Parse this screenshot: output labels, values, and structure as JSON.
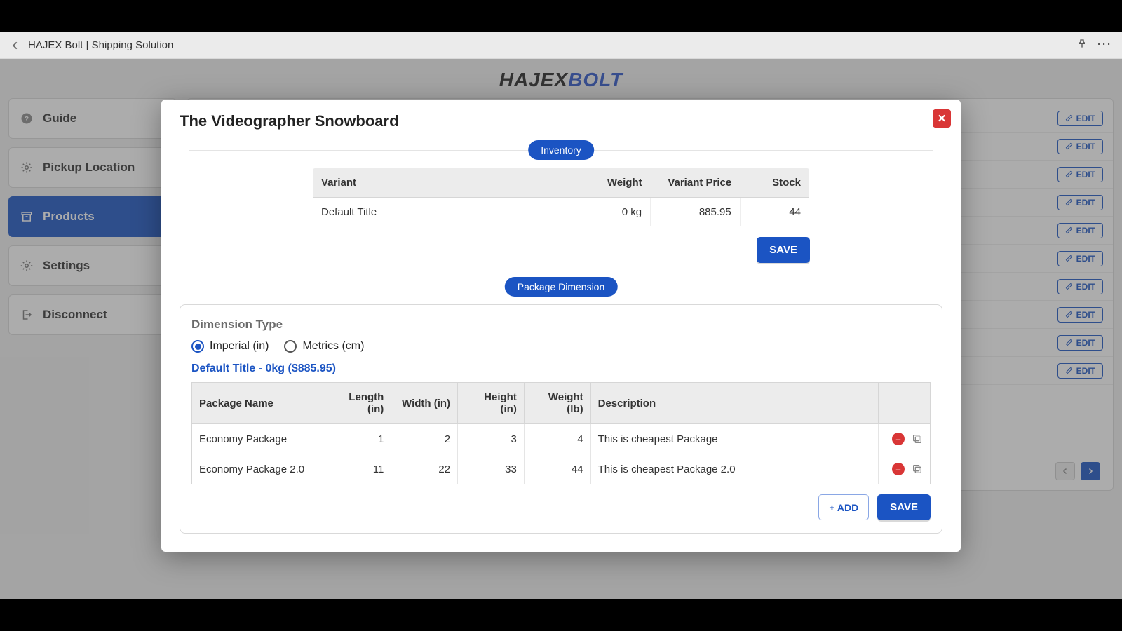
{
  "titlebar": {
    "text": "HAJEX Bolt | Shipping Solution"
  },
  "brand": {
    "part1": "HAJEX",
    "part2": "BOLT"
  },
  "sidebar": {
    "items": [
      {
        "label": "Guide"
      },
      {
        "label": "Pickup Location"
      },
      {
        "label": "Products"
      },
      {
        "label": "Settings"
      },
      {
        "label": "Disconnect"
      }
    ]
  },
  "main": {
    "edit_label": "EDIT",
    "row_count": 10
  },
  "modal": {
    "title": "The Videographer Snowboard",
    "inventory_label": "Inventory",
    "package_dim_label": "Package Dimension",
    "inv_headers": {
      "variant": "Variant",
      "weight": "Weight",
      "price": "Variant Price",
      "stock": "Stock"
    },
    "inv_row": {
      "variant": "Default Title",
      "weight": "0 kg",
      "price": "885.95",
      "stock": "44"
    },
    "save_label": "SAVE",
    "dimension_type_label": "Dimension Type",
    "radio_imperial": "Imperial (in)",
    "radio_metrics": "Metrics (cm)",
    "variant_link": "Default Title - 0kg ($885.95)",
    "pkg_headers": {
      "name": "Package Name",
      "length": "Length (in)",
      "width": "Width (in)",
      "height": "Height (in)",
      "weight": "Weight (lb)",
      "desc": "Description"
    },
    "pkg_rows": [
      {
        "name": "Economy Package",
        "length": "1",
        "width": "2",
        "height": "3",
        "weight": "4",
        "desc": "This is cheapest Package"
      },
      {
        "name": "Economy Package 2.0",
        "length": "11",
        "width": "22",
        "height": "33",
        "weight": "44",
        "desc": "This is cheapest Package 2.0"
      }
    ],
    "add_label": "+ ADD"
  }
}
